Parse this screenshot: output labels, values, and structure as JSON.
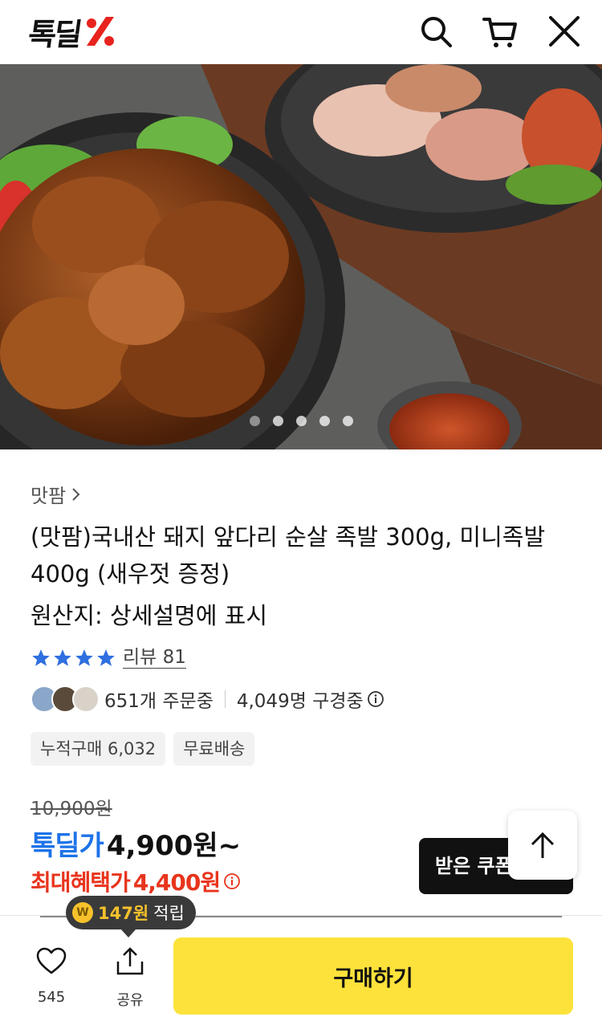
{
  "header": {
    "logo_text": "톡딜",
    "icons": [
      "search-icon",
      "cart-icon",
      "close-icon"
    ]
  },
  "hero": {
    "slides_count": 5,
    "active_slide": 1
  },
  "product": {
    "breadcrumb": "맛팜",
    "title": "(맛팜)국내산 돼지 앞다리 순살 족발 300g, 미니족발 400g (새우젓 증정)",
    "origin": "원산지: 상세설명에 표시",
    "rating_stars": 4,
    "review_label": "리뷰 81",
    "order_count": "651개 주문중",
    "viewer_count": "4,049명 구경중",
    "tags": [
      "누적구매 6,032",
      "무료배송"
    ]
  },
  "price": {
    "original": "10,900원",
    "deal_label": "톡딜가",
    "deal_price": "4,900원~",
    "max_label": "최대혜택가",
    "max_price": "4,400원"
  },
  "coupon": {
    "label": "받은 쿠폰"
  },
  "points": {
    "coin_symbol": "W",
    "amount": "147원",
    "label": "적립"
  },
  "bottom_bar": {
    "like_count": "545",
    "share_label": "공유",
    "buy_label": "구매하기"
  },
  "colors": {
    "deal_blue": "#1e73e8",
    "max_red": "#e8341c",
    "buy_yellow": "#fce23a",
    "star_blue": "#2f6fe0"
  }
}
